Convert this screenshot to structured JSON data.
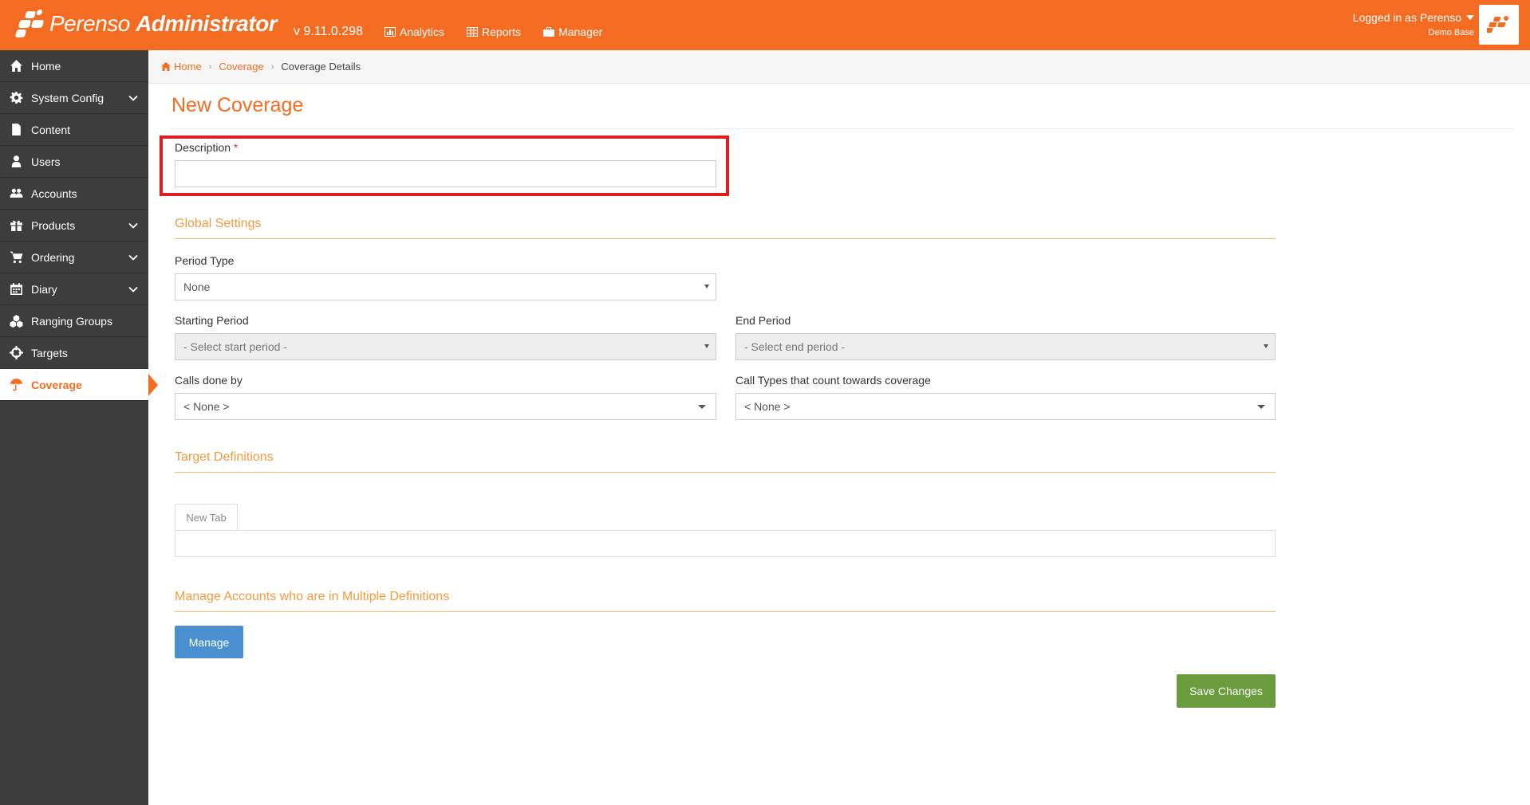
{
  "header": {
    "brand_light": "Perenso",
    "brand_bold": "Administrator",
    "version": "v 9.11.0.298",
    "nav": [
      {
        "label": "Analytics",
        "icon": "bar-chart-icon"
      },
      {
        "label": "Reports",
        "icon": "table-icon"
      },
      {
        "label": "Manager",
        "icon": "briefcase-icon"
      }
    ],
    "user_text": "Logged in as Perenso",
    "base_text": "Demo Base",
    "accent": "#f36c21"
  },
  "sidebar": {
    "items": [
      {
        "label": "Home",
        "icon": "home-icon",
        "expandable": false
      },
      {
        "label": "System Config",
        "icon": "gear-icon",
        "expandable": true
      },
      {
        "label": "Content",
        "icon": "file-icon",
        "expandable": false
      },
      {
        "label": "Users",
        "icon": "user-icon",
        "expandable": false
      },
      {
        "label": "Accounts",
        "icon": "users-icon",
        "expandable": false
      },
      {
        "label": "Products",
        "icon": "gift-icon",
        "expandable": true
      },
      {
        "label": "Ordering",
        "icon": "cart-icon",
        "expandable": true
      },
      {
        "label": "Diary",
        "icon": "calendar-icon",
        "expandable": true
      },
      {
        "label": "Ranging Groups",
        "icon": "cubes-icon",
        "expandable": false
      },
      {
        "label": "Targets",
        "icon": "crosshairs-icon",
        "expandable": false
      },
      {
        "label": "Coverage",
        "icon": "umbrella-icon",
        "expandable": false,
        "active": true
      }
    ]
  },
  "breadcrumb": {
    "home": "Home",
    "coverage": "Coverage",
    "current": "Coverage Details"
  },
  "form": {
    "title": "New Coverage",
    "description_label": "Description",
    "required_mark": "*",
    "description_value": "",
    "global_settings_title": "Global Settings",
    "period_type_label": "Period Type",
    "period_type_value": "None",
    "starting_period_label": "Starting Period",
    "starting_period_value": "- Select start period -",
    "end_period_label": "End Period",
    "end_period_value": "- Select end period -",
    "calls_done_by_label": "Calls done by",
    "calls_done_by_value": "< None >",
    "call_types_label": "Call Types that count towards coverage",
    "call_types_value": "< None >",
    "target_definitions_title": "Target Definitions",
    "new_tab_label": "New Tab",
    "manage_accounts_title": "Manage Accounts who are in Multiple Definitions",
    "manage_button": "Manage",
    "save_button": "Save Changes"
  }
}
